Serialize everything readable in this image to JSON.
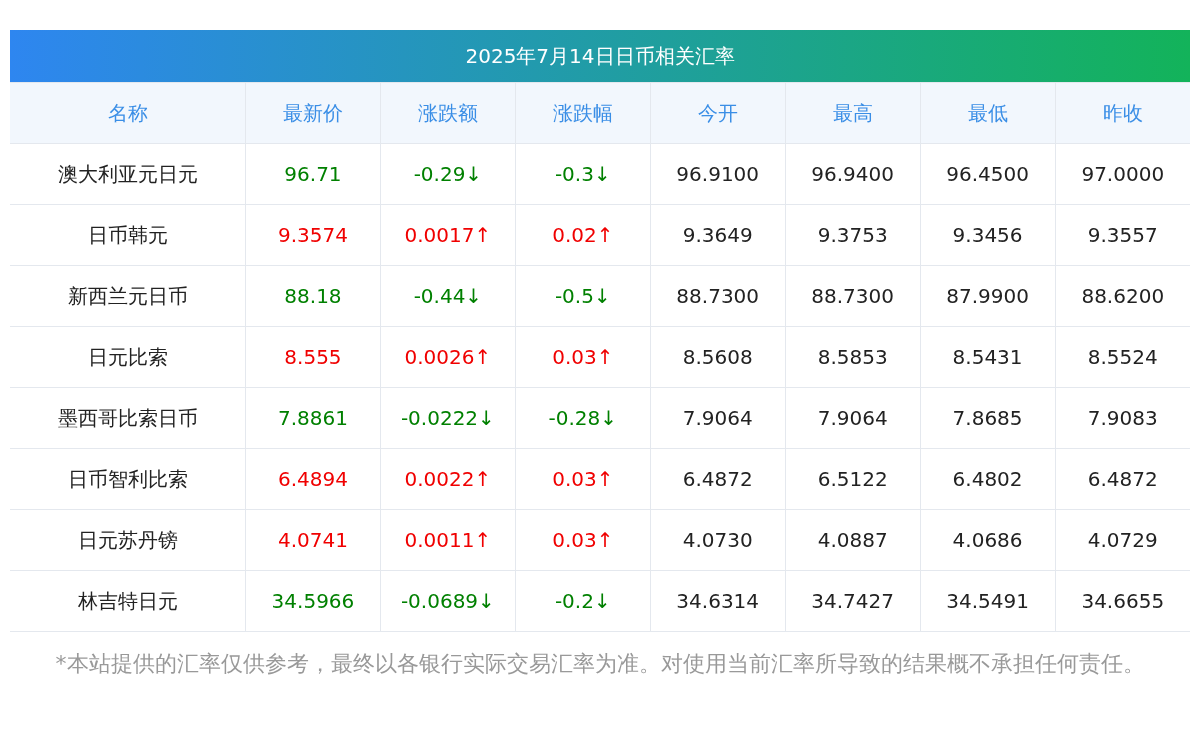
{
  "title": "2025年7月14日日币相关汇率",
  "columns": [
    "名称",
    "最新价",
    "涨跌额",
    "涨跌幅",
    "今开",
    "最高",
    "最低",
    "昨收"
  ],
  "rows": [
    {
      "name": "澳大利亚元日元",
      "color": "#008000",
      "latest": "96.71",
      "change": "-0.29↓",
      "pct": "-0.3↓",
      "open": "96.9100",
      "high": "96.9400",
      "low": "96.4500",
      "prev_close": "97.0000"
    },
    {
      "name": "日币韩元",
      "color": "#f00000",
      "latest": "9.3574",
      "change": "0.0017↑",
      "pct": "0.02↑",
      "open": "9.3649",
      "high": "9.3753",
      "low": "9.3456",
      "prev_close": "9.3557"
    },
    {
      "name": "新西兰元日币",
      "color": "#008000",
      "latest": "88.18",
      "change": "-0.44↓",
      "pct": "-0.5↓",
      "open": "88.7300",
      "high": "88.7300",
      "low": "87.9900",
      "prev_close": "88.6200"
    },
    {
      "name": "日元比索",
      "color": "#f00000",
      "latest": "8.555",
      "change": "0.0026↑",
      "pct": "0.03↑",
      "open": "8.5608",
      "high": "8.5853",
      "low": "8.5431",
      "prev_close": "8.5524"
    },
    {
      "name": "墨西哥比索日币",
      "color": "#008000",
      "latest": "7.8861",
      "change": "-0.0222↓",
      "pct": "-0.28↓",
      "open": "7.9064",
      "high": "7.9064",
      "low": "7.8685",
      "prev_close": "7.9083"
    },
    {
      "name": "日币智利比索",
      "color": "#f00000",
      "latest": "6.4894",
      "change": "0.0022↑",
      "pct": "0.03↑",
      "open": "6.4872",
      "high": "6.5122",
      "low": "6.4802",
      "prev_close": "6.4872"
    },
    {
      "name": "日元苏丹镑",
      "color": "#f00000",
      "latest": "4.0741",
      "change": "0.0011↑",
      "pct": "0.03↑",
      "open": "4.0730",
      "high": "4.0887",
      "low": "4.0686",
      "prev_close": "4.0729"
    },
    {
      "name": "林吉特日元",
      "color": "#008000",
      "latest": "34.5966",
      "change": "-0.0689↓",
      "pct": "-0.2↓",
      "open": "34.6314",
      "high": "34.7427",
      "low": "34.5491",
      "prev_close": "34.6655"
    }
  ],
  "disclaimer": "*本站提供的汇率仅供参考，最终以各银行实际交易汇率为准。对使用当前汇率所导致的结果概不承担任何责任。"
}
